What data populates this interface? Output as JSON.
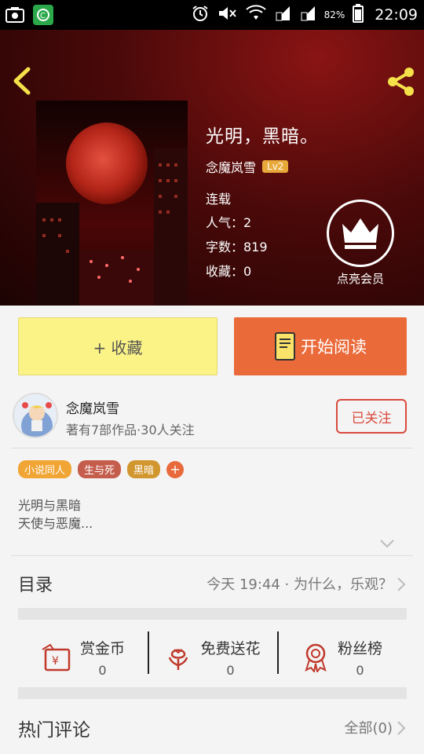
{
  "status_bar": {
    "battery_percent": "82%",
    "time": "22:09",
    "icons": [
      "screenshot-icon",
      "app-icon",
      "alarm-icon",
      "mute-icon",
      "wifi-icon",
      "signal-icon",
      "signal2-icon",
      "battery-icon"
    ]
  },
  "book": {
    "title": "光明，黑暗。",
    "author": "念魔岚雪",
    "level": "Lv2",
    "status": "连载",
    "popularity": "人气：2",
    "word_count": "字数：819",
    "favorites": "收藏：0",
    "vip_label": "点亮会员"
  },
  "actions": {
    "favorite_label": "+ 收藏",
    "read_label": "开始阅读"
  },
  "author_panel": {
    "name": "念魔岚雪",
    "subtitle": "著有7部作品·30人关注",
    "follow_label": "已关注"
  },
  "tags": [
    {
      "label": "小说同人",
      "color": "#f0a535"
    },
    {
      "label": "生与死",
      "color": "#c55d4c"
    },
    {
      "label": "黑暗",
      "color": "#d2962f"
    }
  ],
  "tag_add": "+",
  "description": {
    "line1": "光明与黑暗",
    "line2": "天使与恶魔..."
  },
  "catalog": {
    "title": "目录",
    "latest": "今天 19:44 · 为什么，乐观？"
  },
  "rewards": [
    {
      "label": "赏金币",
      "value": "0",
      "icon": "coin-envelope-icon"
    },
    {
      "label": "免费送花",
      "value": "0",
      "icon": "flower-icon"
    },
    {
      "label": "粉丝榜",
      "value": "0",
      "icon": "medal-icon"
    }
  ],
  "comments": {
    "title": "热门评论",
    "all_label": "全部(0)"
  },
  "colors": {
    "accent_orange": "#ea6a3a",
    "favorite_yellow": "#fbf386",
    "follow_red": "#d94a3d",
    "hero_red": "#6a0c0c"
  }
}
